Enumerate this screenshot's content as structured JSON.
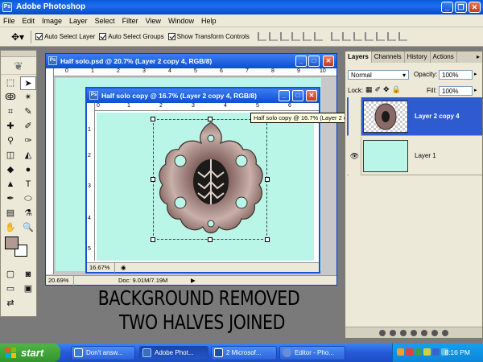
{
  "app": {
    "title": "Adobe Photoshop",
    "icon": "photoshop-app-icon"
  },
  "menu": [
    "File",
    "Edit",
    "Image",
    "Layer",
    "Select",
    "Filter",
    "View",
    "Window",
    "Help"
  ],
  "options_bar": {
    "auto_select_layer": "Auto Select Layer",
    "auto_select_groups": "Auto Select Groups",
    "show_transform_controls": "Show Transform Controls"
  },
  "doc_back": {
    "title": "Half solo.psd @ 20.7% (Layer 2 copy 4, RGB/8)",
    "zoom": "20.69%",
    "docinfo": "Doc: 9.01M/7.19M"
  },
  "doc_front": {
    "title": "Half solo copy @ 16.7% (Layer 2 copy 4, RGB/8)",
    "zoom": "16.67%"
  },
  "tooltip": "Half solo copy @ 16.7% (Layer 2 copy 4, RGB/8)",
  "ruler_back_numbers": [
    "0",
    "1",
    "2",
    "3",
    "4",
    "5",
    "6",
    "7",
    "8",
    "9",
    "10"
  ],
  "ruler_front_numbers": [
    "0",
    "1",
    "2",
    "3",
    "4",
    "5",
    "6"
  ],
  "ruler_front_vertical": [
    "1",
    "2",
    "3",
    "4",
    "5"
  ],
  "caption": {
    "line1": "BACKGROUND REMOVED",
    "line2": "TWO HALVES JOINED"
  },
  "layers_panel": {
    "tabs": [
      "Layers",
      "Channels",
      "History",
      "Actions"
    ],
    "blend_mode": "Normal",
    "opacity_label": "Opacity:",
    "opacity_value": "100%",
    "lock_label": "Lock:",
    "fill_label": "Fill:",
    "fill_value": "100%",
    "layers": [
      {
        "name": "Layer 2 copy 4",
        "selected": true
      },
      {
        "name": "Layer 1",
        "selected": false
      }
    ]
  },
  "colors": {
    "canvas": "#b9f6e8",
    "foreground": "#b09a92",
    "titlebar": "#0a5bd8",
    "selection": "#2e5bd0"
  },
  "taskbar": {
    "start": "start",
    "tasks": [
      "Don't answ...",
      "Adobe Phot...",
      "2 Microsof...",
      "Editor - Pho..."
    ],
    "clock": "8:16 PM"
  }
}
